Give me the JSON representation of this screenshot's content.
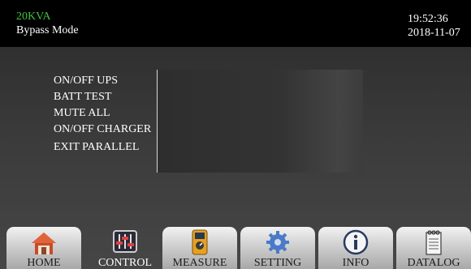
{
  "header": {
    "model": "20KVA",
    "mode": "Bypass Mode",
    "time": "19:52:36",
    "date": "2018-11-07"
  },
  "menu": {
    "items": [
      "ON/OFF UPS",
      "BATT TEST",
      "MUTE ALL",
      "ON/OFF CHARGER",
      "EXIT PARALLEL"
    ]
  },
  "nav": {
    "active": "CONTROL",
    "tabs": [
      {
        "label": "HOME",
        "icon": "home-icon"
      },
      {
        "label": "CONTROL",
        "icon": "sliders-icon"
      },
      {
        "label": "MEASURE",
        "icon": "multimeter-icon"
      },
      {
        "label": "SETTING",
        "icon": "gear-icon"
      },
      {
        "label": "INFO",
        "icon": "info-icon"
      },
      {
        "label": "DATALOG",
        "icon": "notepad-icon"
      }
    ]
  },
  "colors": {
    "model_text": "#3ec43e",
    "header_bg": "#000000",
    "screen_bg": "#3a3a3a"
  }
}
